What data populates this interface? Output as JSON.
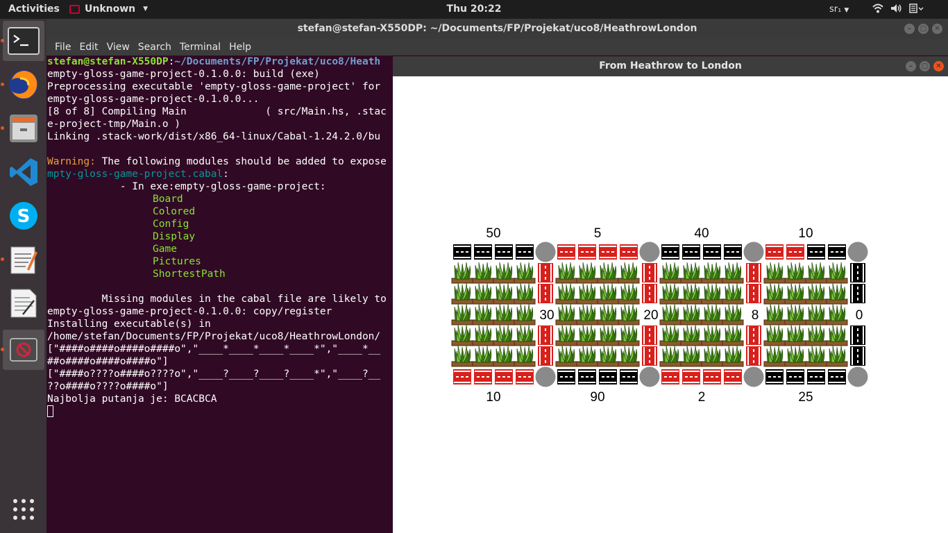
{
  "topbar": {
    "activities": "Activities",
    "app_menu": "Unknown",
    "clock": "Thu 20:22",
    "keyboard": "sr₁"
  },
  "dock": {
    "items": [
      "terminal-app",
      "firefox-app",
      "files-app",
      "vscode-app",
      "skype-app",
      "text-editor-app",
      "libreoffice-writer-app",
      "unknown-app"
    ],
    "apps_grid": "show-applications-icon"
  },
  "terminal": {
    "title": "stefan@stefan-X550DP: ~/Documents/FP/Projekat/uco8/HeathrowLondon",
    "menu": [
      "File",
      "Edit",
      "View",
      "Search",
      "Terminal",
      "Help"
    ],
    "prompt_user": "stefan@stefan-X550DP",
    "prompt_sep": ":",
    "prompt_path": "~/Documents/FP/Projekat/uco8/Heath",
    "lines": {
      "l1": "empty-gloss-game-project-0.1.0.0: build (exe)",
      "l2": "Preprocessing executable 'empty-gloss-game-project' for",
      "l3": "empty-gloss-game-project-0.1.0.0...",
      "l4": "[8 of 8] Compiling Main             ( src/Main.hs, .stac",
      "l5": "e-project-tmp/Main.o )",
      "l6": "Linking .stack-work/dist/x86_64-linux/Cabal-1.24.2.0/bu",
      "warn_label": "Warning:",
      "warn_text": " The following modules should be added to expose",
      "cabal_file": "mpty-gloss-game-project.cabal",
      "cabal_colon": ":",
      "in_exe": "            - In exe:empty-gloss-game-project:",
      "modules": [
        "Board",
        "Colored",
        "Config",
        "Display",
        "Game",
        "Pictures",
        "ShortestPath"
      ],
      "missing": "         Missing modules in the cabal file are likely to",
      "copy": "empty-gloss-game-project-0.1.0.0: copy/register",
      "installing": "Installing executable(s) in",
      "home": "/home/stefan/Documents/FP/Projekat/uco8/HeathrowLondon/",
      "board1a": "[\"####o####o####o####o\",\"____*____*____*____*\",\"____*__",
      "board1b": "##o####o####o####o\"]",
      "board2a": "[\"####o????o####o????o\",\"____?____?____?____*\",\"____?__",
      "board2b": "??o####o????o####o\"]",
      "result": "Najbolja putanja je: BCACBCA"
    }
  },
  "gloss": {
    "title": "From Heathrow to London",
    "top_labels": [
      "50",
      "5",
      "40",
      "10"
    ],
    "side_labels": [
      "30",
      "20",
      "8",
      "0"
    ],
    "bottom_labels": [
      "10",
      "90",
      "2",
      "25"
    ],
    "top_road_colors": [
      [
        "black",
        "black",
        "black",
        "black"
      ],
      [
        "red",
        "red",
        "red",
        "red"
      ],
      [
        "black",
        "black",
        "black",
        "black"
      ],
      [
        "red",
        "red",
        "black",
        "black"
      ]
    ],
    "bottom_road_colors": [
      [
        "red",
        "red",
        "red",
        "red"
      ],
      [
        "black",
        "black",
        "black",
        "black"
      ],
      [
        "red",
        "red",
        "red",
        "red"
      ],
      [
        "black",
        "black",
        "black",
        "black"
      ]
    ],
    "vertical_road_colors": [
      "red",
      "red",
      "red",
      "black"
    ],
    "colors": {
      "red_road": "#d8201c",
      "black_road": "#000000",
      "node": "#8a8a8a",
      "grass_dark": "#3b7a12",
      "grass_light": "#7fc241",
      "planter": "#8b5a2b"
    }
  }
}
